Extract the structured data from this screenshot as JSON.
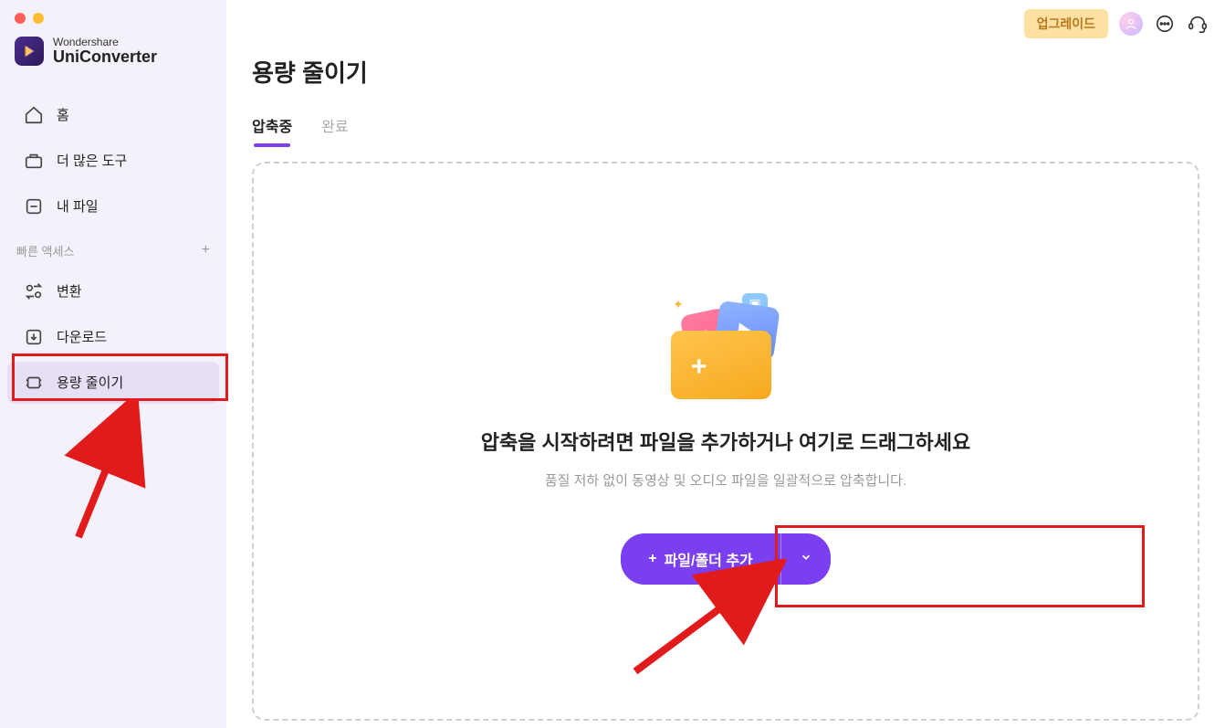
{
  "brand": {
    "line1": "Wondershare",
    "line2_a": "Uni",
    "line2_b": "Converter"
  },
  "nav": {
    "home": "홈",
    "more_tools": "더 많은 도구",
    "my_files": "내 파일"
  },
  "quick_access": {
    "header": "빠른 액세스",
    "items": {
      "convert": "변환",
      "download": "다운로드",
      "compress": "용량 줄이기"
    }
  },
  "topbar": {
    "upgrade": "업그레이드"
  },
  "page": {
    "title": "용량 줄이기",
    "tabs": {
      "compressing": "압축중",
      "done": "완료"
    }
  },
  "dropzone": {
    "heading": "압축을 시작하려면 파일을 추가하거나 여기로 드래그하세요",
    "sub": "품질 저하 없이 동영상 및 오디오 파일을 일괄적으로 압축합니다.",
    "add_btn": "파일/폴더 추가"
  },
  "colors": {
    "accent": "#7b3ff2",
    "sidebar_bg": "#f5f1fb",
    "highlight": "#e11b1b",
    "upgrade_bg": "#ffe0a3"
  }
}
